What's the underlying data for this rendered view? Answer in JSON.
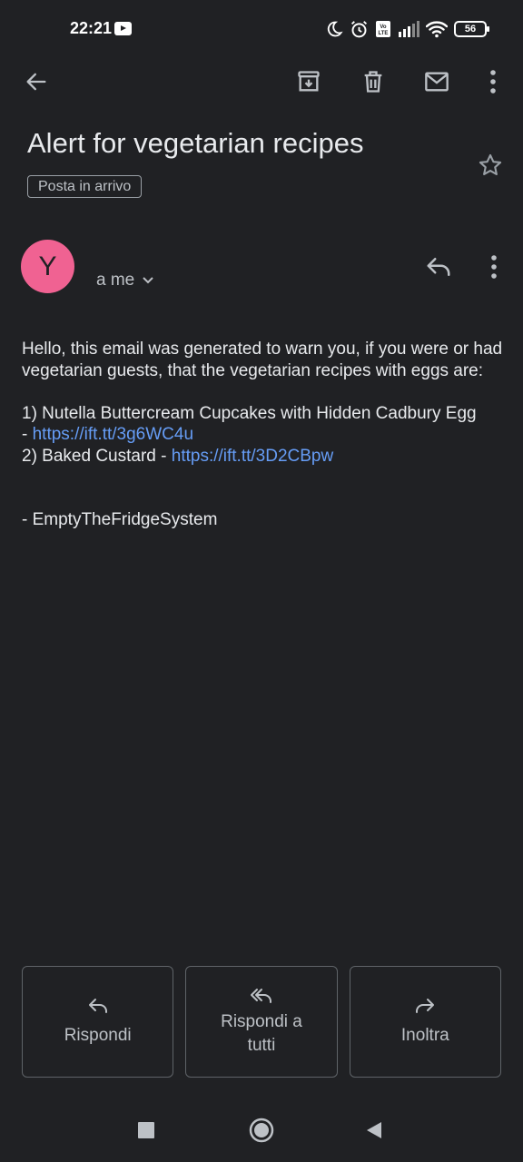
{
  "status_bar": {
    "time": "22:21",
    "battery": "56",
    "icons": [
      "youtube-icon",
      "moon-icon",
      "alarm-icon",
      "volte-icon",
      "signal-icon",
      "wifi-icon",
      "battery-icon"
    ]
  },
  "toolbar": {
    "icons": [
      "back-arrow-icon",
      "archive-icon",
      "trash-icon",
      "mail-icon",
      "more-vert-icon"
    ]
  },
  "email": {
    "subject": "Alert for vegetarian recipes",
    "label": "Posta in arrivo",
    "avatar_letter": "Y",
    "recipient": "a me",
    "intro": "Hello, this email was generated to warn you, if you were or had vegetarian guests, that the vegetarian recipes with eggs are:",
    "item1_text": "1) Nutella Buttercream Cupcakes with Hidden Cadbury Egg",
    "item1_prefix": "- ",
    "item1_link": "https://ift.tt/3g6WC4u",
    "item2_text": "2) Baked Custard - ",
    "item2_link": "https://ift.tt/3D2CBpw",
    "signature": "- EmptyTheFridgeSystem"
  },
  "actions": {
    "reply": "Rispondi",
    "reply_all_line1": "Rispondi a",
    "reply_all_line2": "tutti",
    "forward": "Inoltra"
  },
  "colors": {
    "background": "#202124",
    "avatar": "#f06292",
    "link": "#669df6"
  }
}
